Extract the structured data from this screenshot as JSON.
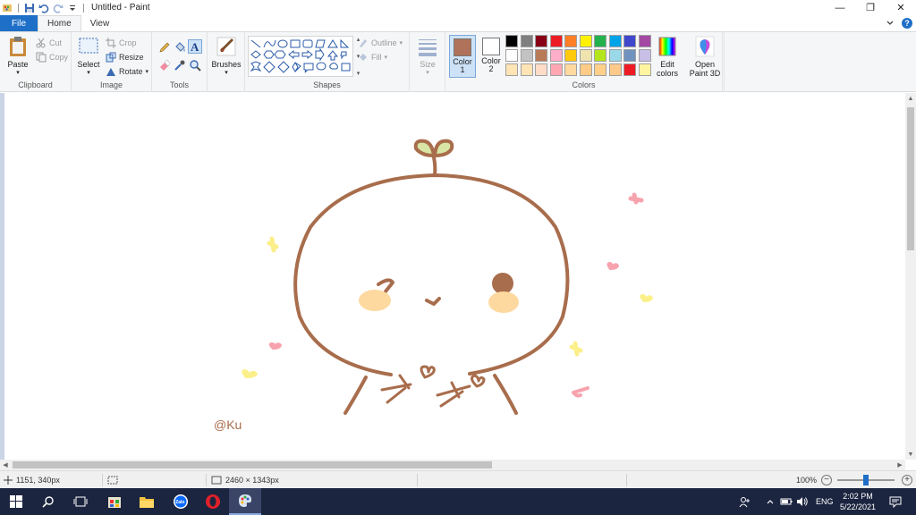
{
  "window": {
    "title": "Untitled - Paint",
    "minimize": "—",
    "restore": "❐",
    "close": "✕"
  },
  "tabs": [
    {
      "label": "File"
    },
    {
      "label": "Home"
    },
    {
      "label": "View"
    }
  ],
  "ribbon": {
    "clipboard": {
      "label": "Clipboard",
      "paste": "Paste",
      "cut": "Cut",
      "copy": "Copy"
    },
    "image": {
      "label": "Image",
      "select": "Select",
      "crop": "Crop",
      "resize": "Resize",
      "rotate": "Rotate"
    },
    "tools": {
      "label": "Tools"
    },
    "brushes": {
      "label": "Brushes"
    },
    "shapes": {
      "label": "Shapes",
      "outline": "Outline",
      "fill": "Fill"
    },
    "size": {
      "label": "Size"
    },
    "colors": {
      "label": "Colors",
      "color1": "Color 1",
      "color2": "Color 2",
      "color1_value": "#b0725a",
      "color2_value": "#ffffff",
      "edit_colors": "Edit colors",
      "palette_row1": [
        "#000000",
        "#7f7f7f",
        "#880015",
        "#ed1c24",
        "#ff7f27",
        "#fff200",
        "#22b14c",
        "#00a2e8",
        "#3f48cc",
        "#a349a4"
      ],
      "palette_row2": [
        "#ffffff",
        "#c3c3c3",
        "#b97a57",
        "#ffaec9",
        "#ffc90e",
        "#efe4b0",
        "#b5e61d",
        "#99d9ea",
        "#7092be",
        "#c8bfe7"
      ],
      "palette_row3": [
        "#ffe4b5",
        "#ffe4b5",
        "#ffdcc8",
        "#ffa8b4",
        "#ffd9a0",
        "#ffcc88",
        "#ffd08a",
        "#ffc98a",
        "#ed1c24",
        "#fff4a0"
      ]
    },
    "paint3d": {
      "label": "Open Paint 3D"
    }
  },
  "canvas": {
    "signature": "@Ku",
    "line_color": "#a86d4c"
  },
  "status": {
    "cursor_pos": "1151, 340px",
    "image_size": "2460 × 1343px",
    "zoom": "100%"
  },
  "taskbar": {
    "time": "2:02 PM",
    "date": "5/22/2021",
    "lang": "ENG",
    "zalo": "Zalo"
  }
}
